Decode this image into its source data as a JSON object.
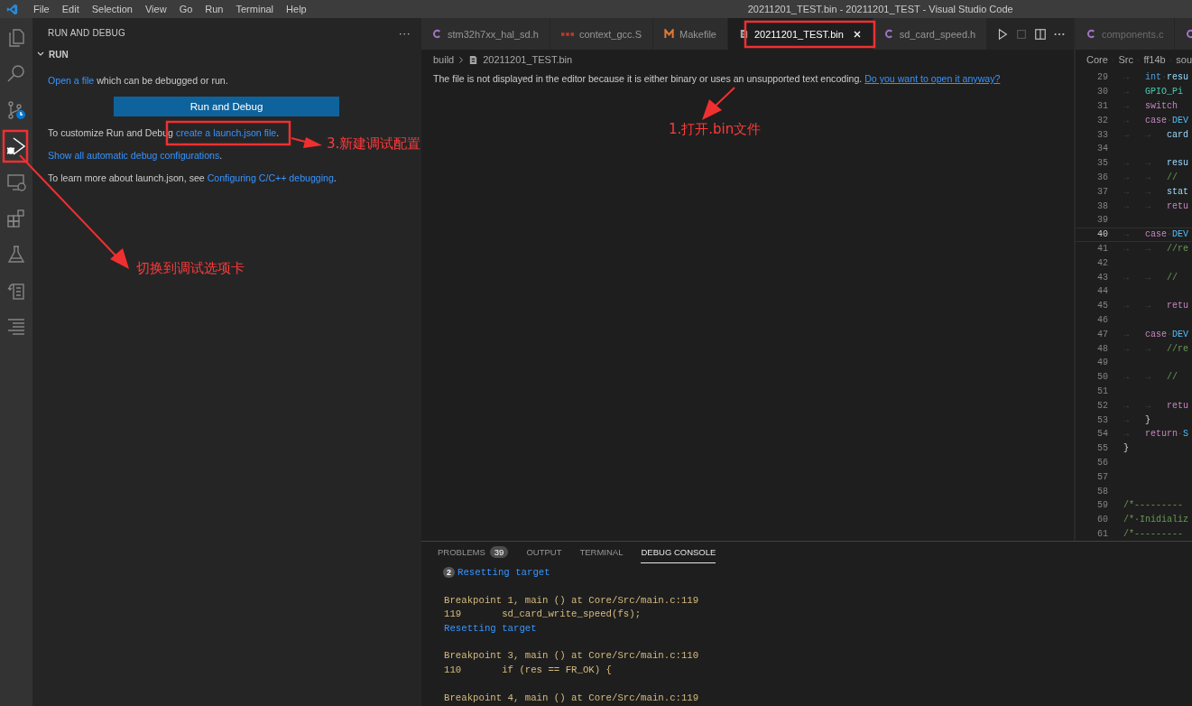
{
  "menu_bar": {
    "items": [
      "File",
      "Edit",
      "Selection",
      "View",
      "Go",
      "Run",
      "Terminal",
      "Help"
    ]
  },
  "window": {
    "title": "20211201_TEST.bin - 20211201_TEST - Visual Studio Code"
  },
  "activity_bar": [
    {
      "kind": "files",
      "selected": false
    },
    {
      "kind": "search",
      "selected": false
    },
    {
      "kind": "source-control",
      "selected": false
    },
    {
      "kind": "run-debug",
      "selected": true
    },
    {
      "kind": "remote",
      "selected": false
    },
    {
      "kind": "extensions",
      "selected": false
    },
    {
      "kind": "testing",
      "selected": false
    },
    {
      "kind": "notes",
      "selected": false
    },
    {
      "kind": "outline",
      "selected": false
    }
  ],
  "sidebar": {
    "title": "RUN AND DEBUG",
    "more": "···",
    "section": {
      "title": "RUN",
      "expanded": true
    },
    "open_line": {
      "link": "Open a file",
      "text": " which can be debugged or run."
    },
    "button": "Run and Debug",
    "customize_line": {
      "text": "To customize Run and Debug ",
      "link": "create a launch.json file",
      "end": "."
    },
    "show_all": {
      "link": "Show all automatic debug configurations",
      "end": "."
    },
    "learn_line": {
      "text": "To learn more about launch.json, see ",
      "link": "Configuring C/C++ debugging",
      "end": "."
    }
  },
  "editor": {
    "tabs": [
      {
        "label": "stm32h7xx_hal_sd.h",
        "kind": "c",
        "selected": false
      },
      {
        "label": "context_gcc.S",
        "kind": "asm",
        "selected": false
      },
      {
        "label": "Makefile",
        "kind": "make",
        "selected": false
      },
      {
        "label": "20211201_TEST.bin",
        "kind": "file",
        "selected": true
      },
      {
        "label": "sd_card_speed.h",
        "kind": "c",
        "selected": false
      }
    ],
    "breadcrumb": [
      "build",
      "20211201_TEST.bin"
    ],
    "message": "The file is not displayed in the editor because it is either binary or uses an unsupported text encoding. ",
    "message_link": "Do you want to open it anyway?"
  },
  "side_editor": {
    "tabs": [
      {
        "label": "components.c",
        "kind": "c",
        "selected": false
      },
      {
        "kind": "c",
        "selected": false
      }
    ],
    "breadcrumb": [
      "Core",
      "Src",
      "ff14b",
      "sou"
    ],
    "lines": [
      {
        "n": "29",
        "current": false,
        "code": [
          {
            "t": "→   ",
            "kind": "ws"
          },
          {
            "t": "int",
            "kind": "type"
          },
          {
            "t": "·",
            "kind": "ws"
          },
          {
            "t": "resu",
            "kind": "var"
          }
        ]
      },
      {
        "n": "30",
        "current": false,
        "code": [
          {
            "t": "→   ",
            "kind": "ws"
          },
          {
            "t": "GPIO_Pi",
            "kind": "macro"
          }
        ]
      },
      {
        "n": "31",
        "current": false,
        "code": [
          {
            "t": "→   ",
            "kind": "ws"
          },
          {
            "t": "switch",
            "kind": "kw"
          }
        ]
      },
      {
        "n": "32",
        "current": false,
        "code": [
          {
            "t": "→   ",
            "kind": "ws"
          },
          {
            "t": "case",
            "kind": "kw"
          },
          {
            "t": "·",
            "kind": "ws"
          },
          {
            "t": "DEV",
            "kind": "const"
          }
        ]
      },
      {
        "n": "33",
        "current": false,
        "code": [
          {
            "t": "→   →   ",
            "kind": "ws"
          },
          {
            "t": "card",
            "kind": "var"
          }
        ]
      },
      {
        "n": "34",
        "current": false
      },
      {
        "n": "35",
        "current": false,
        "code": [
          {
            "t": "→   →   ",
            "kind": "ws"
          },
          {
            "t": "resu",
            "kind": "var"
          }
        ]
      },
      {
        "n": "36",
        "current": false,
        "code": [
          {
            "t": "→   →   ",
            "kind": "ws"
          },
          {
            "t": "//",
            "kind": "comment"
          }
        ]
      },
      {
        "n": "37",
        "current": false,
        "code": [
          {
            "t": "→   →   ",
            "kind": "ws"
          },
          {
            "t": "stat",
            "kind": "var"
          }
        ]
      },
      {
        "n": "38",
        "current": false,
        "code": [
          {
            "t": "→   →   ",
            "kind": "ws"
          },
          {
            "t": "retu",
            "kind": "kw"
          }
        ]
      },
      {
        "n": "39",
        "current": false
      },
      {
        "n": "40",
        "current": true,
        "code": [
          {
            "t": "→   ",
            "kind": "ws"
          },
          {
            "t": "case",
            "kind": "kw"
          },
          {
            "t": "·",
            "kind": "ws"
          },
          {
            "t": "DEV",
            "kind": "const"
          }
        ]
      },
      {
        "n": "41",
        "current": false,
        "code": [
          {
            "t": "→   →   ",
            "kind": "ws"
          },
          {
            "t": "//re",
            "kind": "comment"
          }
        ]
      },
      {
        "n": "42",
        "current": false
      },
      {
        "n": "43",
        "current": false,
        "code": [
          {
            "t": "→   →   ",
            "kind": "ws"
          },
          {
            "t": "//",
            "kind": "comment"
          }
        ]
      },
      {
        "n": "44",
        "current": false
      },
      {
        "n": "45",
        "current": false,
        "code": [
          {
            "t": "→   →   ",
            "kind": "ws"
          },
          {
            "t": "retu",
            "kind": "kw"
          }
        ]
      },
      {
        "n": "46",
        "current": false
      },
      {
        "n": "47",
        "current": false,
        "code": [
          {
            "t": "→   ",
            "kind": "ws"
          },
          {
            "t": "case",
            "kind": "kw"
          },
          {
            "t": "·",
            "kind": "ws"
          },
          {
            "t": "DEV",
            "kind": "const"
          }
        ]
      },
      {
        "n": "48",
        "current": false,
        "code": [
          {
            "t": "→   →   ",
            "kind": "ws"
          },
          {
            "t": "//re",
            "kind": "comment"
          }
        ]
      },
      {
        "n": "49",
        "current": false
      },
      {
        "n": "50",
        "current": false,
        "code": [
          {
            "t": "→   →   ",
            "kind": "ws"
          },
          {
            "t": "//",
            "kind": "comment"
          }
        ]
      },
      {
        "n": "51",
        "current": false
      },
      {
        "n": "52",
        "current": false,
        "code": [
          {
            "t": "→   →   ",
            "kind": "ws"
          },
          {
            "t": "retu",
            "kind": "kw"
          }
        ]
      },
      {
        "n": "53",
        "current": false,
        "code": [
          {
            "t": "→   ",
            "kind": "ws"
          },
          {
            "t": "}",
            "kind": "plain"
          }
        ]
      },
      {
        "n": "54",
        "current": false,
        "code": [
          {
            "t": "→   ",
            "kind": "ws"
          },
          {
            "t": "return",
            "kind": "kw"
          },
          {
            "t": "·",
            "kind": "ws"
          },
          {
            "t": "S",
            "kind": "const"
          }
        ]
      },
      {
        "n": "55",
        "current": false,
        "code": [
          {
            "t": "}",
            "kind": "plain"
          }
        ]
      },
      {
        "n": "56",
        "current": false
      },
      {
        "n": "57",
        "current": false
      },
      {
        "n": "58",
        "current": false
      },
      {
        "n": "59",
        "current": false,
        "code": [
          {
            "t": "/*---------",
            "kind": "comment"
          }
        ]
      },
      {
        "n": "60",
        "current": false,
        "code": [
          {
            "t": "/*·Inidializ",
            "kind": "comment"
          }
        ]
      },
      {
        "n": "61",
        "current": false,
        "code": [
          {
            "t": "/*---------",
            "kind": "comment"
          }
        ]
      }
    ]
  },
  "panel": {
    "tabs": [
      {
        "label": "PROBLEMS",
        "badge": "39",
        "selected": false
      },
      {
        "label": "OUTPUT",
        "selected": false
      },
      {
        "label": "TERMINAL",
        "selected": false
      },
      {
        "label": "DEBUG CONSOLE",
        "selected": true
      }
    ],
    "console": [
      [
        {
          "text": "Resetting target",
          "kind": "info",
          "count": "2"
        }
      ],
      [
        {
          "text": "Breakpoint 1, main () at Core/Src/main.c:119",
          "kind": "output"
        },
        {
          "text": "119       sd_card_write_speed(fs);",
          "kind": "output"
        },
        {
          "text": "Resetting target",
          "kind": "info"
        }
      ],
      [
        {
          "text": "Breakpoint 3, main () at Core/Src/main.c:110",
          "kind": "output"
        },
        {
          "text": "110       if (res == FR_OK) {",
          "kind": "output"
        }
      ],
      [
        {
          "text": "Breakpoint 4, main () at Core/Src/main.c:119",
          "kind": "output"
        }
      ]
    ]
  },
  "annotations": [
    {
      "text": "1.打开.bin文件"
    },
    {
      "text": "3.新建调试配置"
    },
    {
      "text": "切换到调试选项卡"
    }
  ]
}
